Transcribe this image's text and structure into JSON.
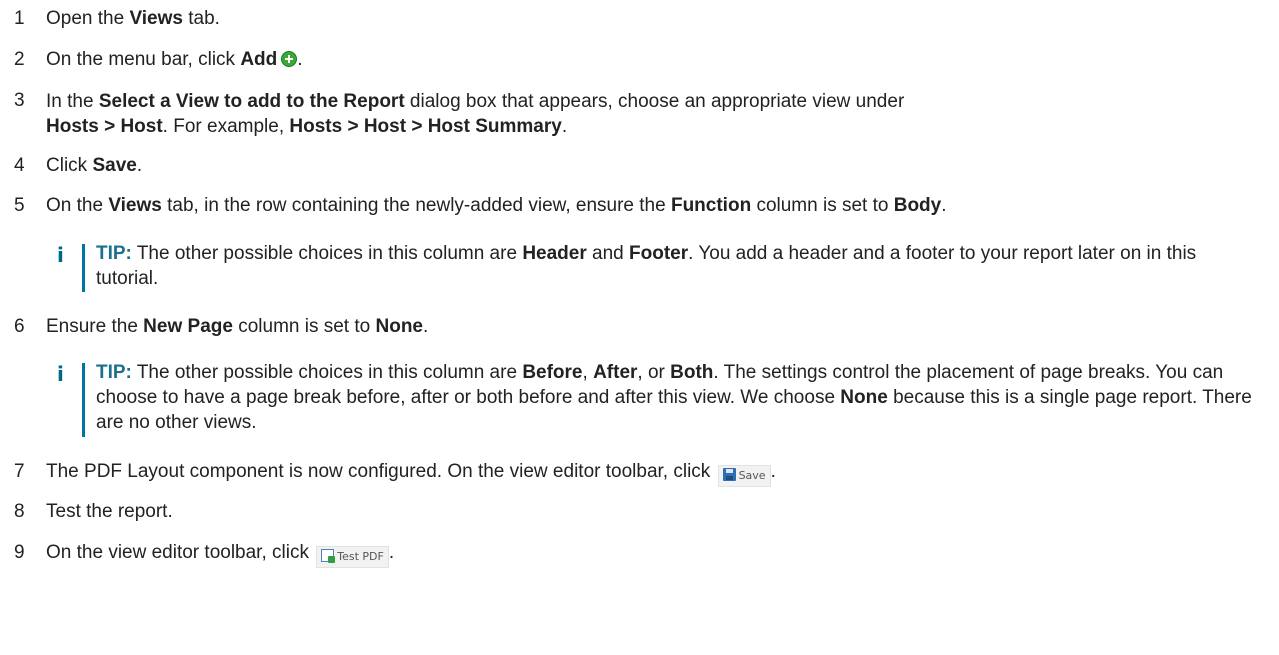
{
  "steps": [
    {
      "num": "1",
      "parts": [
        "Open the ",
        "Views",
        " tab."
      ]
    },
    {
      "num": "2",
      "parts": [
        "On the menu bar, click ",
        "Add",
        "."
      ]
    },
    {
      "num": "3",
      "parts": [
        "In the ",
        "Select a View to add to the Report",
        " dialog box that appears, choose an appropriate view under ",
        "Hosts > Host",
        ". For example, ",
        "Hosts > Host > Host Summary",
        "."
      ]
    },
    {
      "num": "4",
      "parts": [
        "Click ",
        "Save",
        "."
      ]
    },
    {
      "num": "5",
      "parts": [
        "On the ",
        "Views",
        " tab, in the row containing the newly-added view, ensure the ",
        "Function",
        " column is set to ",
        "Body",
        "."
      ]
    },
    {
      "num": "6",
      "parts": [
        "Ensure the ",
        "New Page",
        " column is set to ",
        "None",
        "."
      ]
    },
    {
      "num": "7",
      "parts": [
        "The PDF Layout component is now configured. On the view editor toolbar, click ",
        "."
      ]
    },
    {
      "num": "8",
      "parts": [
        "Test the report."
      ]
    },
    {
      "num": "9",
      "parts": [
        "On the view editor toolbar, click ",
        "."
      ]
    }
  ],
  "tips": [
    {
      "icon_glyph": "i",
      "label": "TIP:",
      "parts": [
        " The other possible choices in this column are ",
        "Header",
        " and ",
        "Footer",
        ". You add a header and a footer to your report later on in this tutorial."
      ]
    },
    {
      "icon_glyph": "i",
      "label": "TIP:",
      "parts": [
        " The other possible choices in this column are ",
        "Before",
        ", ",
        "After",
        ", or ",
        "Both",
        ". The settings control the placement of page breaks. You can choose to have a page break before, after or both before and after this view. We choose ",
        "None",
        " because this is a single page report. There are no other views."
      ]
    }
  ],
  "buttons": {
    "save": {
      "label": "Save",
      "icon": "floppy-disk-icon"
    },
    "test_pdf": {
      "label": "Test PDF",
      "icon": "test-pdf-icon"
    },
    "add": {
      "icon": "green-plus-circle-icon"
    }
  },
  "colors": {
    "tip_label": "#1b6f8f",
    "tip_bar": "#0073a8",
    "add_icon": "#3aa93a"
  }
}
